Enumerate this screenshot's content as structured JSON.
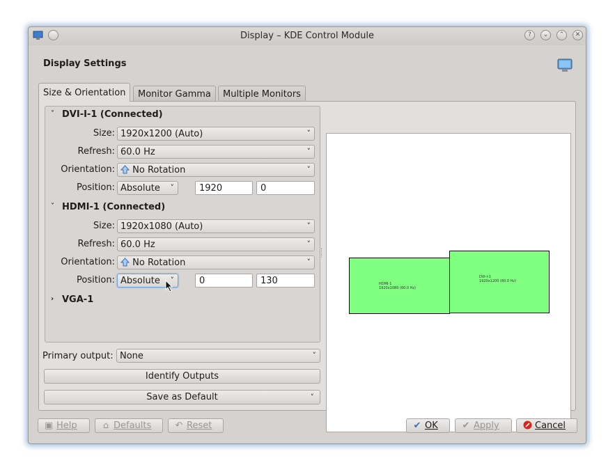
{
  "window": {
    "title": "Display – KDE Control Module",
    "heading": "Display Settings"
  },
  "tabs": [
    {
      "label": "Size & Orientation",
      "active": true
    },
    {
      "label": "Monitor Gamma",
      "active": false
    },
    {
      "label": "Multiple Monitors",
      "active": false
    }
  ],
  "outputs": {
    "dvi": {
      "title": "DVI-I-1 (Connected)",
      "size_label": "Size:",
      "size": "1920x1200 (Auto)",
      "refresh_label": "Refresh:",
      "refresh": "60.0 Hz",
      "orientation_label": "Orientation:",
      "orientation": "No Rotation",
      "position_label": "Position:",
      "position_mode": "Absolute",
      "pos_x": "1920",
      "pos_y": "0"
    },
    "hdmi": {
      "title": "HDMI-1 (Connected)",
      "size_label": "Size:",
      "size": "1920x1080 (Auto)",
      "refresh_label": "Refresh:",
      "refresh": "60.0 Hz",
      "orientation_label": "Orientation:",
      "orientation": "No Rotation",
      "position_label": "Position:",
      "position_mode": "Absolute",
      "pos_x": "0",
      "pos_y": "130"
    },
    "vga": {
      "title": "VGA-1"
    }
  },
  "primary": {
    "label": "Primary output:",
    "value": "None"
  },
  "actions": {
    "identify": "Identify Outputs",
    "save_default": "Save as Default"
  },
  "preview": {
    "hdmi_name": "HDMI-1",
    "hdmi_mode": "1920x1080 (60.0 Hz)",
    "dvi_name": "DVI-I-1",
    "dvi_mode": "1920x1200 (60.0 Hz)"
  },
  "footer": {
    "help": "Help",
    "defaults": "Defaults",
    "reset": "Reset",
    "ok": "OK",
    "apply": "Apply",
    "cancel": "Cancel"
  },
  "colors": {
    "monitor_fill": "#80ff80",
    "cancel_icon": "#d9261c",
    "ok_check": "#3a6fb0"
  }
}
